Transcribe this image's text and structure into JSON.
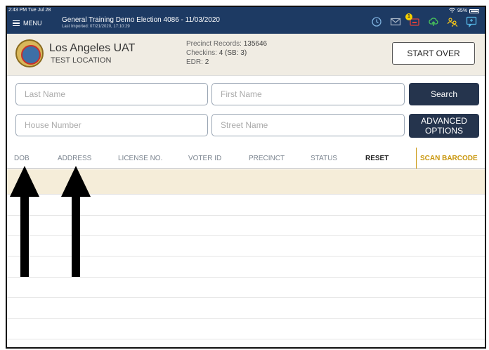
{
  "status": {
    "time": "2:43 PM  Tue Jul 28",
    "battery": "95%"
  },
  "topbar": {
    "menu_label": "MENU",
    "election_title": "General Training  Demo Election 4086 - 11/03/2020",
    "last_imported": "Last Imported: 07/21/2020, 17:10:29",
    "notification_count": "1",
    "icons": [
      "history-icon",
      "mail-icon",
      "cartridge-icon",
      "cloud-upload-icon",
      "users-icon",
      "chat-icon"
    ]
  },
  "location": {
    "name": "Los Angeles UAT",
    "subtitle": "TEST LOCATION",
    "precinct_records_label": "Precinct Records:",
    "precinct_records_value": "135646",
    "checkins_label": "Checkins:",
    "checkins_value": "4 (SB: 3)",
    "edr_label": "EDR:",
    "edr_value": "2",
    "start_over_label": "START OVER"
  },
  "search": {
    "last_name_placeholder": "Last Name",
    "first_name_placeholder": "First Name",
    "search_label": "Search",
    "house_number_placeholder": "House Number",
    "street_name_placeholder": "Street Name",
    "advanced_label_1": "ADVANCED",
    "advanced_label_2": "OPTIONS"
  },
  "columns": {
    "dob": "DOB",
    "address": "ADDRESS",
    "license": "LICENSE NO.",
    "voter_id": "VOTER ID",
    "precinct": "PRECINCT",
    "status": "STATUS",
    "reset": "RESET",
    "scan_barcode": "SCAN BARCODE"
  },
  "colors": {
    "topbar": "#1d3a63",
    "button_dark": "#25344d",
    "accent_gold": "#c9960c",
    "highlight_row": "#f5edd9"
  }
}
